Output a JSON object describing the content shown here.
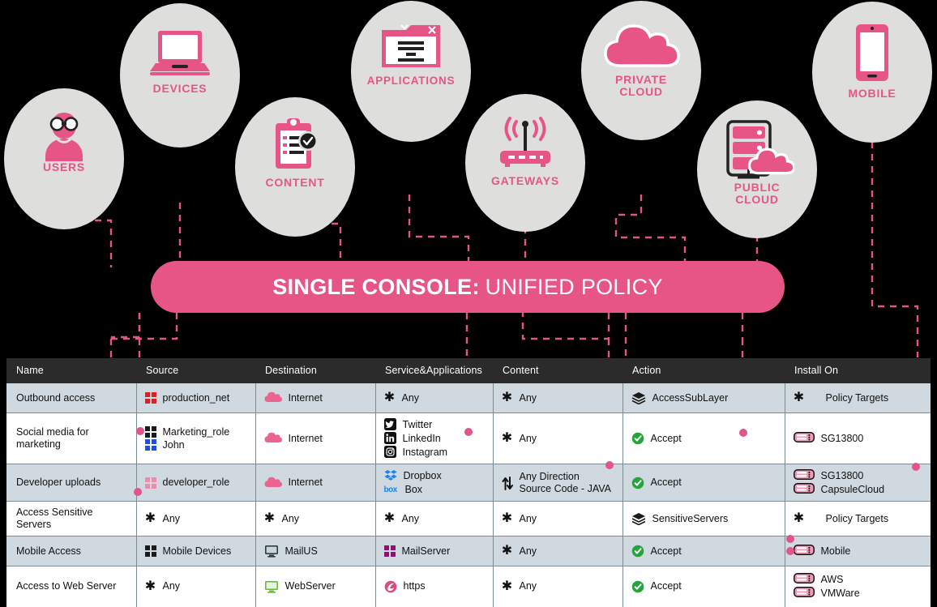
{
  "nodes": [
    {
      "id": "users",
      "label": "USERS",
      "icon": "user-icon"
    },
    {
      "id": "devices",
      "label": "DEVICES",
      "icon": "laptop-icon"
    },
    {
      "id": "content",
      "label": "CONTENT",
      "icon": "clipboard-check-icon"
    },
    {
      "id": "applications",
      "label": "APPLICATIONS",
      "icon": "app-window-icon"
    },
    {
      "id": "gateways",
      "label": "GATEWAYS",
      "icon": "router-icon"
    },
    {
      "id": "private_cloud",
      "label": "PRIVATE CLOUD",
      "icon": "cloud-icon"
    },
    {
      "id": "public_cloud",
      "label": "PUBLIC CLOUD",
      "icon": "server-cloud-icon"
    },
    {
      "id": "mobile",
      "label": "MOBILE",
      "icon": "smartphone-icon"
    }
  ],
  "banner": {
    "bold_text": "SINGLE CONSOLE:",
    "light_text": "UNIFIED POLICY"
  },
  "table": {
    "columns": [
      "Name",
      "Source",
      "Destination",
      "Service&Applications",
      "Content",
      "Action",
      "Install On"
    ],
    "rows": [
      {
        "name": "Outbound access",
        "source": [
          {
            "icon": "grid-red-icon",
            "text": "production_net"
          }
        ],
        "destination": [
          {
            "icon": "cloud-pink-icon",
            "text": "Internet"
          }
        ],
        "service": [
          {
            "icon": "asterisk-icon",
            "text": "Any"
          }
        ],
        "content": [
          {
            "icon": "asterisk-icon",
            "text": "Any"
          }
        ],
        "action": [
          {
            "icon": "layers-icon",
            "text": "AccessSubLayer"
          }
        ],
        "install": [
          {
            "icon": "asterisk-icon",
            "text": "Policy Targets"
          }
        ]
      },
      {
        "name": "Social media for marketing",
        "source": [
          {
            "icon": "grid-black-icon",
            "text": "Marketing_role"
          },
          {
            "icon": "grid-blue-icon",
            "text": "John"
          }
        ],
        "destination": [
          {
            "icon": "cloud-pink-icon",
            "text": "Internet"
          }
        ],
        "service": [
          {
            "icon": "twitter-icon",
            "text": "Twitter"
          },
          {
            "icon": "linkedin-icon",
            "text": "LinkedIn"
          },
          {
            "icon": "instagram-icon",
            "text": "Instagram"
          }
        ],
        "content": [
          {
            "icon": "asterisk-icon",
            "text": "Any"
          }
        ],
        "action": [
          {
            "icon": "accept-check-icon",
            "text": "Accept"
          }
        ],
        "install": [
          {
            "icon": "gateway-icon",
            "text": "SG13800"
          }
        ]
      },
      {
        "name": "Developer uploads",
        "source": [
          {
            "icon": "grid-pink-icon",
            "text": "developer_role"
          }
        ],
        "destination": [
          {
            "icon": "cloud-pink-icon",
            "text": "Internet"
          }
        ],
        "service": [
          {
            "icon": "dropbox-icon",
            "text": "Dropbox"
          },
          {
            "icon": "box-icon",
            "text": "Box"
          }
        ],
        "content": [
          {
            "icon": "any-direction-icon",
            "text": "Any Direction",
            "text2": "Source Code - JAVA"
          }
        ],
        "action": [
          {
            "icon": "accept-check-icon",
            "text": "Accept"
          }
        ],
        "install": [
          {
            "icon": "gateway-icon",
            "text": "SG13800"
          },
          {
            "icon": "gateway-icon",
            "text": "CapsuleCloud"
          }
        ]
      },
      {
        "name": "Access Sensitive Servers",
        "source": [
          {
            "icon": "asterisk-icon",
            "text": "Any"
          }
        ],
        "destination": [
          {
            "icon": "asterisk-icon",
            "text": "Any"
          }
        ],
        "service": [
          {
            "icon": "asterisk-icon",
            "text": "Any"
          }
        ],
        "content": [
          {
            "icon": "asterisk-icon",
            "text": "Any"
          }
        ],
        "action": [
          {
            "icon": "layers-icon",
            "text": "SensitiveServers"
          }
        ],
        "install": [
          {
            "icon": "asterisk-icon",
            "text": "Policy Targets"
          }
        ]
      },
      {
        "name": "Mobile Access",
        "source": [
          {
            "icon": "grid-black-icon",
            "text": "Mobile Devices"
          }
        ],
        "destination": [
          {
            "icon": "monitor-dark-icon",
            "text": "MailUS"
          }
        ],
        "service": [
          {
            "icon": "grid-purple-icon",
            "text": "MailServer"
          }
        ],
        "content": [
          {
            "icon": "asterisk-icon",
            "text": "Any"
          }
        ],
        "action": [
          {
            "icon": "accept-check-icon",
            "text": "Accept"
          }
        ],
        "install": [
          {
            "icon": "gateway-icon",
            "text": "Mobile"
          }
        ]
      },
      {
        "name": "Access to Web Server",
        "source": [
          {
            "icon": "asterisk-icon",
            "text": "Any"
          }
        ],
        "destination": [
          {
            "icon": "monitor-green-icon",
            "text": "WebServer"
          }
        ],
        "service": [
          {
            "icon": "https-icon",
            "text": "https"
          }
        ],
        "content": [
          {
            "icon": "asterisk-icon",
            "text": "Any"
          }
        ],
        "action": [
          {
            "icon": "accept-check-icon",
            "text": "Accept"
          }
        ],
        "install": [
          {
            "icon": "gateway-icon",
            "text": "AWS"
          },
          {
            "icon": "gateway-icon",
            "text": "VMWare"
          }
        ]
      }
    ]
  },
  "colors": {
    "accent_pink": "#e65586",
    "circle_gray": "#dededc",
    "header_dark": "#2b2b2b",
    "row_blue_gray": "#cfd9df",
    "row_white": "#ffffff",
    "accept_green": "#22a63a",
    "background": "#000000"
  }
}
